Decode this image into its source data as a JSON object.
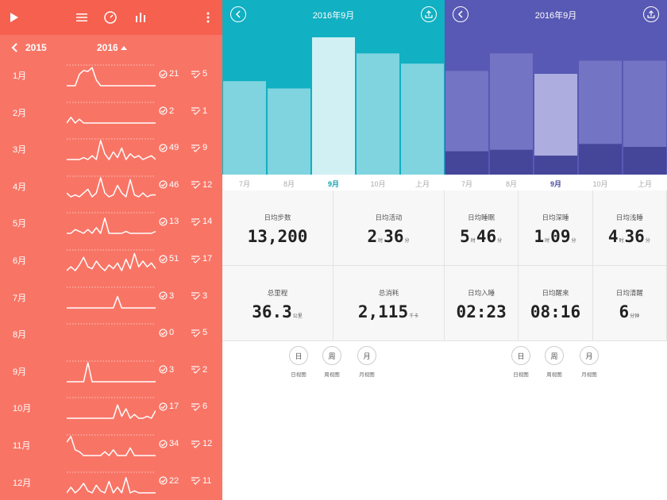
{
  "colors": {
    "p1_bg": "#f87566",
    "p1_header": "#f6604f",
    "teal_header": "#11b0c2",
    "teal_bar": "#7fd4e0",
    "teal_sel": "#d0f0f4",
    "purple_header": "#5859b4",
    "purple_bar": "#7474c4",
    "purple_sel": "#adaddf",
    "purple_dark": "#45469a"
  },
  "yearly": {
    "prev_year": "2015",
    "cur_year": "2016",
    "months": [
      {
        "label": "1月",
        "goals": "21",
        "checks": "5",
        "pts": [
          0,
          0,
          0,
          0.6,
          0.8,
          0.75,
          0.95,
          0.3,
          0,
          0,
          0,
          0,
          0,
          0,
          0,
          0,
          0,
          0,
          0,
          0,
          0,
          0
        ]
      },
      {
        "label": "2月",
        "goals": "2",
        "checks": "1",
        "pts": [
          0,
          0.3,
          0,
          0.2,
          0,
          0,
          0,
          0,
          0,
          0,
          0,
          0,
          0,
          0,
          0,
          0,
          0,
          0,
          0,
          0,
          0,
          0
        ]
      },
      {
        "label": "3月",
        "goals": "49",
        "checks": "9",
        "pts": [
          0,
          0,
          0,
          0,
          0.1,
          0,
          0.2,
          0,
          1.0,
          0.3,
          0,
          0.4,
          0.1,
          0.6,
          0,
          0.3,
          0.1,
          0.2,
          0,
          0.1,
          0.2,
          0
        ]
      },
      {
        "label": "4月",
        "goals": "46",
        "checks": "12",
        "pts": [
          0.2,
          0,
          0.1,
          0,
          0.2,
          0.4,
          0,
          0.2,
          1.0,
          0.2,
          0,
          0.1,
          0.6,
          0.2,
          0,
          0.9,
          0.1,
          0,
          0.2,
          0,
          0.1,
          0.1
        ]
      },
      {
        "label": "5月",
        "goals": "13",
        "checks": "14",
        "pts": [
          0,
          0,
          0.2,
          0.1,
          0,
          0.2,
          0,
          0.3,
          0,
          0.8,
          0,
          0,
          0,
          0,
          0.1,
          0,
          0,
          0,
          0,
          0,
          0,
          0.1
        ]
      },
      {
        "label": "6月",
        "goals": "51",
        "checks": "17",
        "pts": [
          0,
          0.2,
          0,
          0.3,
          0.7,
          0.2,
          0.1,
          0.5,
          0.2,
          0,
          0.3,
          0.1,
          0.4,
          0,
          0.6,
          0.1,
          0.9,
          0.2,
          0.5,
          0.2,
          0.4,
          0.1
        ]
      },
      {
        "label": "7月",
        "goals": "3",
        "checks": "3",
        "pts": [
          0,
          0,
          0,
          0,
          0,
          0,
          0,
          0,
          0,
          0,
          0,
          0,
          0.6,
          0,
          0,
          0,
          0,
          0,
          0,
          0,
          0,
          0
        ]
      },
      {
        "label": "8月",
        "goals": "0",
        "checks": "5",
        "pts": []
      },
      {
        "label": "9月",
        "goals": "3",
        "checks": "2",
        "pts": [
          0,
          0,
          0,
          0,
          0,
          1.0,
          0,
          0,
          0,
          0,
          0,
          0,
          0,
          0,
          0,
          0,
          0,
          0,
          0,
          0,
          0,
          0
        ]
      },
      {
        "label": "10月",
        "goals": "17",
        "checks": "6",
        "pts": [
          0,
          0,
          0,
          0,
          0,
          0,
          0,
          0,
          0,
          0,
          0,
          0,
          0.7,
          0.1,
          0.5,
          0,
          0.2,
          0,
          0,
          0.1,
          0,
          0.4
        ]
      },
      {
        "label": "11月",
        "goals": "34",
        "checks": "12",
        "pts": [
          0.7,
          1.0,
          0.3,
          0.2,
          0,
          0,
          0,
          0,
          0,
          0.2,
          0,
          0.3,
          0,
          0,
          0,
          0.4,
          0,
          0,
          0,
          0,
          0,
          0
        ]
      },
      {
        "label": "12月",
        "goals": "22",
        "checks": "11",
        "pts": [
          0,
          0.3,
          0,
          0.2,
          0.5,
          0.1,
          0,
          0.4,
          0.1,
          0,
          0.6,
          0,
          0.3,
          0,
          0.8,
          0,
          0.1,
          0,
          0,
          0,
          0,
          0
        ]
      }
    ]
  },
  "steps_view": {
    "title": "2016年9月",
    "bars": [
      0.64,
      0.59,
      0.94,
      0.83,
      0.76
    ],
    "selected_index": 2,
    "months": [
      "7月",
      "8月",
      "9月",
      "10月",
      "上月"
    ],
    "cells": [
      {
        "label": "日均步数",
        "parts": [
          {
            "v": "13,200"
          }
        ]
      },
      {
        "label": "日均活动",
        "parts": [
          {
            "v": "2"
          },
          {
            "u": "时"
          },
          {
            "v": "36"
          },
          {
            "u": "分"
          }
        ]
      },
      {
        "label": "总里程",
        "parts": [
          {
            "v": "36.3"
          },
          {
            "u": "公里"
          }
        ]
      },
      {
        "label": "总消耗",
        "parts": [
          {
            "v": "2,115"
          },
          {
            "u": "千卡"
          }
        ]
      }
    ],
    "footer": [
      {
        "icon": "日",
        "label": "日视图"
      },
      {
        "icon": "周",
        "label": "周视图"
      },
      {
        "icon": "月",
        "label": "月视图"
      }
    ]
  },
  "sleep_view": {
    "title": "2016年9月",
    "bars": [
      {
        "total": 0.71,
        "deep": 0.16
      },
      {
        "total": 0.83,
        "deep": 0.17
      },
      {
        "total": 0.69,
        "deep": 0.13
      },
      {
        "total": 0.78,
        "deep": 0.21
      },
      {
        "total": 0.78,
        "deep": 0.19
      }
    ],
    "selected_index": 2,
    "months": [
      "7月",
      "8月",
      "9月",
      "10月",
      "上月"
    ],
    "cells": [
      {
        "label": "日均睡眠",
        "parts": [
          {
            "v": "5"
          },
          {
            "u": "时"
          },
          {
            "v": "46"
          },
          {
            "u": "分"
          }
        ]
      },
      {
        "label": "日均深睡",
        "parts": [
          {
            "v": "1"
          },
          {
            "u": "时"
          },
          {
            "v": "09"
          },
          {
            "u": "分"
          }
        ]
      },
      {
        "label": "日均浅睡",
        "parts": [
          {
            "v": "4"
          },
          {
            "u": "时"
          },
          {
            "v": "36"
          },
          {
            "u": "分"
          }
        ]
      },
      {
        "label": "日均入睡",
        "parts": [
          {
            "v": "02:23"
          }
        ]
      },
      {
        "label": "日均醒来",
        "parts": [
          {
            "v": "08:16"
          }
        ]
      },
      {
        "label": "日均清醒",
        "parts": [
          {
            "v": "6"
          },
          {
            "u": "分钟"
          }
        ]
      }
    ],
    "footer": [
      {
        "icon": "日",
        "label": "日视图"
      },
      {
        "icon": "周",
        "label": "周视图"
      },
      {
        "icon": "月",
        "label": "月视图"
      }
    ]
  }
}
